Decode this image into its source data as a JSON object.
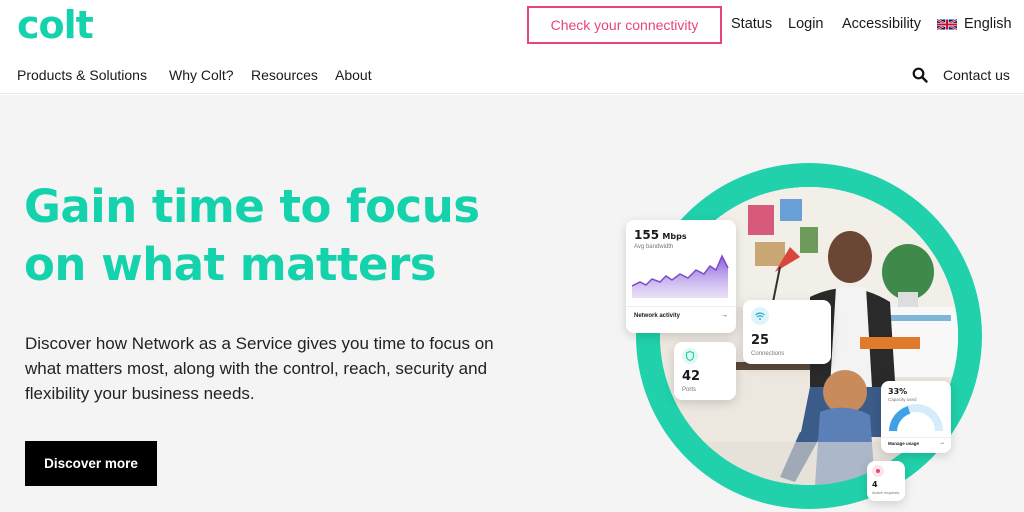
{
  "header": {
    "logo": "colt",
    "check_connectivity": "Check your connectivity",
    "status": "Status",
    "login": "Login",
    "accessibility": "Accessibility",
    "language": "English",
    "language_flag_icon": "uk-flag-icon",
    "search_icon": "search-icon",
    "contact_us": "Contact us"
  },
  "nav": {
    "items": [
      {
        "label": "Products & Solutions"
      },
      {
        "label": "Why Colt?"
      },
      {
        "label": "Resources"
      },
      {
        "label": "About"
      }
    ]
  },
  "hero": {
    "headline_line1": "Gain time to focus",
    "headline_line2": "on what matters",
    "description": "Discover how Network as a Service gives you time to focus on what matters most, along with the control, reach, security and flexibility your business needs.",
    "cta_label": "Discover more"
  },
  "cards": {
    "bandwidth": {
      "value": "155",
      "unit": "Mbps",
      "label": "Avg bandwidth",
      "footer": "Network activity",
      "arrow": "→"
    },
    "connections": {
      "value": "25",
      "label": "Connections"
    },
    "ports": {
      "value": "42",
      "label": "Ports"
    },
    "capacity": {
      "value": "33%",
      "label": "Capacity used",
      "footer": "Manage usage",
      "arrow": "→"
    },
    "requests": {
      "value": "4",
      "label": "Active requests"
    }
  },
  "colors": {
    "brand": "#14d2ac",
    "accent_pink": "#e8457a",
    "cta_bg": "#000000",
    "hero_bg": "#f4f4f4"
  }
}
